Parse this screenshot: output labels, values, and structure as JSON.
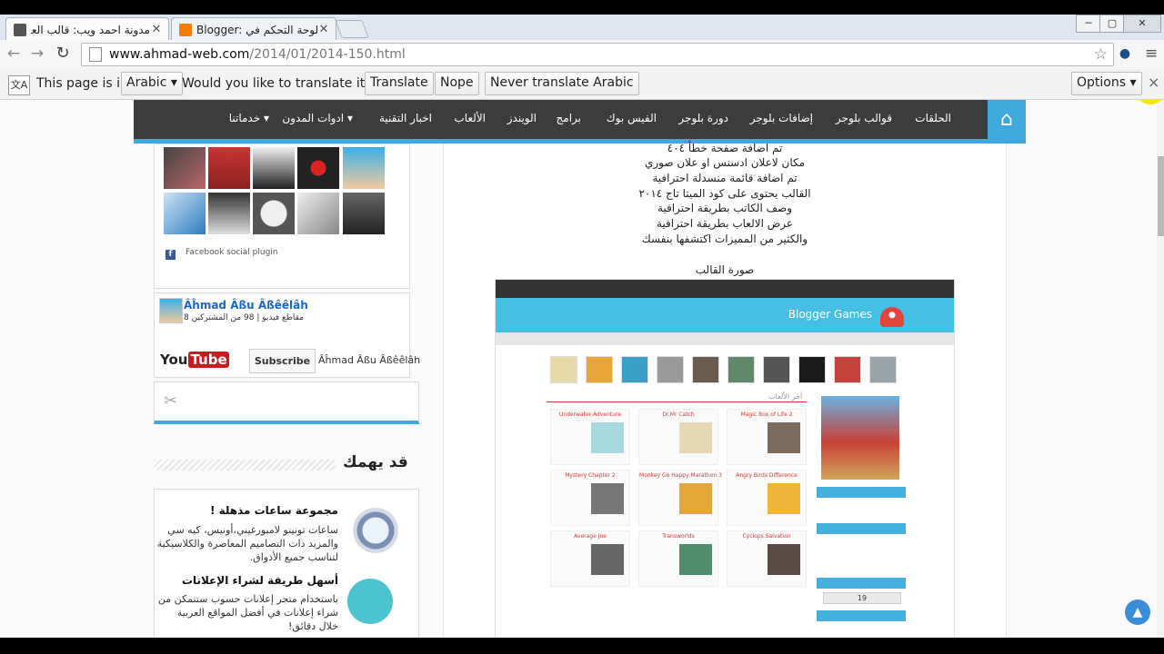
{
  "browser": {
    "tabs": [
      {
        "title": "مدونة احمد ويب: قالب العاب فلاش",
        "active": true
      },
      {
        "title": "Blogger: لوحة التحكم في Blo",
        "active": false
      }
    ],
    "window_controls": {
      "minimize": "─",
      "maximize": "▢",
      "close": "✕"
    },
    "url_host": "www.ahmad-web.com",
    "url_path": "/2014/01/2014-150.html"
  },
  "translate_bar": {
    "page_is_in": "This page is in",
    "language": "Arabic",
    "question": "Would you like to translate it?",
    "translate": "Translate",
    "nope": "Nope",
    "never": "Never translate Arabic",
    "options": "Options",
    "close": "×"
  },
  "nav": {
    "home_icon": "home-icon",
    "items": [
      "الحلقات",
      "قوالب بلوجر",
      "إضافات بلوجر",
      "دورة بلوجر",
      "الفيس بوك",
      "برامج",
      "الويندز",
      "الألعاب",
      "اخبار التقنية",
      "ادوات المدون ▾",
      "خدماتنا ▾"
    ]
  },
  "sidebar": {
    "facebook_plugin": "Facebook social plugin",
    "youtube": {
      "channel_name": "Âĥmad Âßu Âßêêlâh",
      "subtitle": "مقاطع فيديو | 98 من المشتركين 8",
      "logo_you": "You",
      "logo_tube": "Tube",
      "subscribe": "Subscribe",
      "channel_label": "Âĥmad Âßu Âßêêlâh"
    },
    "section_title": "قد يهمك",
    "ads": [
      {
        "title": "مجموعة ساعات مذهلة !",
        "body": "ساعات تونينو لامبورغيني،أونيس، كيه سي والمزيد ذات التصاميم المعاصرة والكلاسيكية لتناسب جميع الأذواق."
      },
      {
        "title": "أسهل طريقة لشراء الإعلانات",
        "body": "باستخدام متجر إعلانات حسوب ستتمكن من شراء إعلانات في أفضل المواقع العربية خلال دقائق!"
      }
    ]
  },
  "content": {
    "features": [
      "تم اضافة صفحة خطأ ٤٠٤",
      "مكان لاعلان ادسنس او علان صوري",
      "تم اضافة قائمة منسدلة احترافية",
      "القالب يحتوى على كود الميتا تاج ٢٠١٤",
      "وصف الكاتب بطريقة احترافية",
      "عرض الالعاب بطريقة احترافية",
      "والكثير من المميزات اكتشفها بنفسك"
    ],
    "image_caption": "صورة القالب",
    "template_preview": {
      "title": "Blogger Games",
      "latest": "آخر الألعاب",
      "counter": "19",
      "cards": [
        "Underwater Adventure",
        "Dr.Mr Catch",
        "Magic Box of Life 2",
        "Mystery Chapter 2",
        "Monkey Go Happy Marathon 3",
        "Angry Birds Difference",
        "Average Joe",
        "Transworlds",
        "Cyclops Salvation"
      ]
    }
  },
  "colors": {
    "accent": "#3fa9de",
    "nav_bg": "#3c3c3c"
  }
}
